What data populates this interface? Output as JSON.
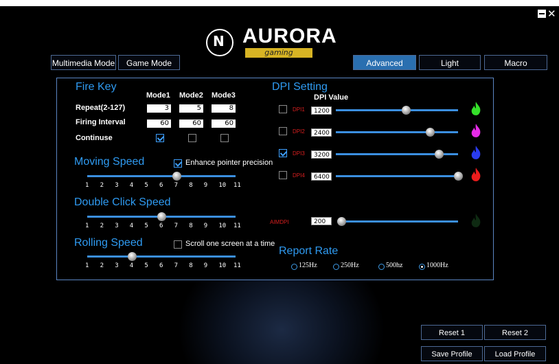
{
  "window": {
    "minimize_label": "−",
    "close_label": "✕"
  },
  "logo": {
    "letter": "N",
    "name": "AURORA",
    "sub": "gaming"
  },
  "tabs": {
    "multimedia": "Multimedia Mode",
    "game": "Game Mode",
    "advanced": "Advanced",
    "light": "Light",
    "macro": "Macro"
  },
  "fire_key": {
    "title": "Fire Key",
    "modes": [
      "Mode1",
      "Mode2",
      "Mode3"
    ],
    "repeat_label": "Repeat(2-127)",
    "repeat_values": [
      "3",
      "5",
      "8"
    ],
    "interval_label": "Firing Interval",
    "interval_values": [
      "60",
      "60",
      "60"
    ],
    "continue_label": "Continuse",
    "continue_checked": [
      true,
      false,
      false
    ]
  },
  "moving_speed": {
    "title": "Moving Speed",
    "enhance_label": "Enhance pointer precision",
    "enhance_checked": true,
    "ticks": [
      "1",
      "2",
      "3",
      "4",
      "5",
      "6",
      "7",
      "8",
      "9",
      "10",
      "11"
    ],
    "value": 7
  },
  "double_click": {
    "title": "Double Click Speed",
    "ticks": [
      "1",
      "2",
      "3",
      "4",
      "5",
      "6",
      "7",
      "8",
      "9",
      "10",
      "11"
    ],
    "value": 6
  },
  "rolling_speed": {
    "title": "Rolling Speed",
    "scroll_label": "Scroll one screen at a time",
    "scroll_checked": false,
    "ticks": [
      "1",
      "2",
      "3",
      "4",
      "5",
      "6",
      "7",
      "8",
      "9",
      "10",
      "11"
    ],
    "value": 4
  },
  "dpi": {
    "title": "DPI Setting",
    "value_header": "DPI Value",
    "rows": [
      {
        "name": "DPI1",
        "value": "1200",
        "checked": false,
        "color": "#35e02a",
        "level": 0.56
      },
      {
        "name": "DPI2",
        "value": "2400",
        "checked": false,
        "color": "#e52be6",
        "level": 0.76
      },
      {
        "name": "DPI3",
        "value": "3200",
        "checked": true,
        "color": "#2a3cf0",
        "level": 0.84
      },
      {
        "name": "DPI4",
        "value": "6400",
        "checked": false,
        "color": "#ee1c1c",
        "level": 1.0
      }
    ],
    "aim_label": "AIMDPI",
    "aim_value": "200",
    "aim_level": 0.0,
    "aim_color": "#0e2a12"
  },
  "report_rate": {
    "title": "Report Rate",
    "options": [
      "125Hz",
      "250Hz",
      "500hz",
      "1000Hz"
    ],
    "selected": 3
  },
  "buttons": {
    "reset1": "Reset 1",
    "reset2": "Reset 2",
    "save": "Save Profile",
    "load": "Load Profile"
  }
}
